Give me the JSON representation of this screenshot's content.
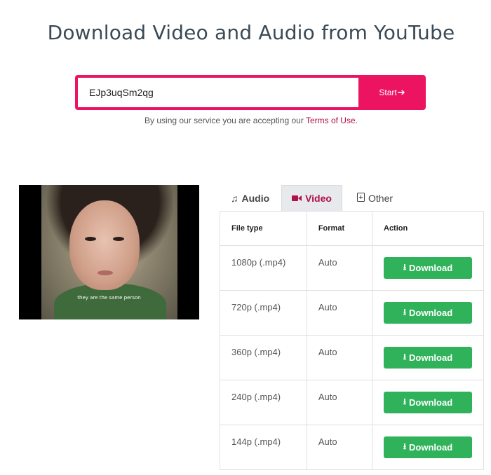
{
  "header": {
    "title": "Download Video and Audio from YouTube"
  },
  "search": {
    "value": "EJp3uqSm2qg",
    "start_label": "Start",
    "start_icon": "arrow-right-icon"
  },
  "terms": {
    "prefix": "By using our service you are accepting our ",
    "link": "Terms of Use",
    "suffix": "."
  },
  "video": {
    "caption": "they are the same person"
  },
  "tabs": [
    {
      "label": "Audio",
      "icon": "music-note-icon",
      "active": false
    },
    {
      "label": "Video",
      "icon": "video-camera-icon",
      "active": true
    },
    {
      "label": "Other",
      "icon": "file-icon",
      "active": false
    }
  ],
  "table": {
    "headers": [
      "File type",
      "Format",
      "Action"
    ],
    "download_label": "Download",
    "rows": [
      {
        "file_type": "1080p (.mp4)",
        "format": "Auto"
      },
      {
        "file_type": "720p (.mp4)",
        "format": "Auto"
      },
      {
        "file_type": "360p (.mp4)",
        "format": "Auto"
      },
      {
        "file_type": "240p (.mp4)",
        "format": "Auto"
      },
      {
        "file_type": "144p (.mp4)",
        "format": "Auto"
      }
    ]
  },
  "colors": {
    "accent": "#ec1461",
    "link": "#b0104c",
    "download": "#2fb25a"
  }
}
